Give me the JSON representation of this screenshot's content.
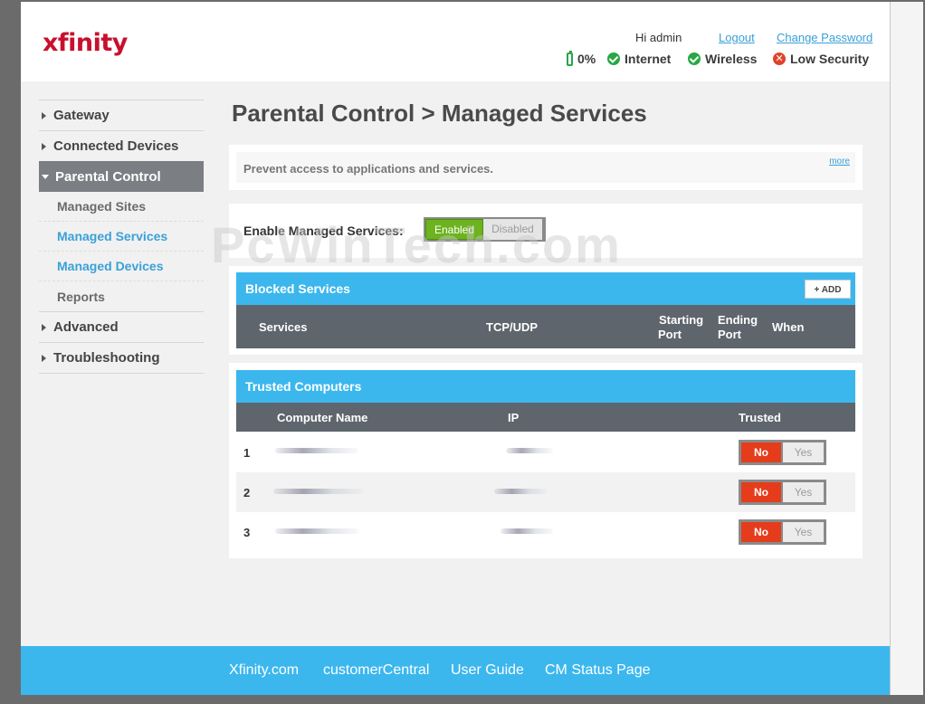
{
  "header": {
    "logo": "xfinity",
    "greeting": "Hi admin",
    "logout": "Logout",
    "change_password": "Change Password",
    "battery": "0%",
    "internet": "Internet",
    "wireless": "Wireless",
    "security": "Low Security"
  },
  "sidebar": {
    "gateway": "Gateway",
    "connected_devices": "Connected Devices",
    "parental_control": "Parental Control",
    "managed_sites": "Managed Sites",
    "managed_services": "Managed Services",
    "managed_devices": "Managed Devices",
    "reports": "Reports",
    "advanced": "Advanced",
    "troubleshooting": "Troubleshooting"
  },
  "main": {
    "title": "Parental Control > Managed Services",
    "description": "Prevent access to applications and services.",
    "more": "more",
    "enable_label": "Enable Managed Services:",
    "enabled": "Enabled",
    "disabled": "Disabled",
    "toggle_state": "Enabled"
  },
  "blocked": {
    "title": "Blocked Services",
    "add": "+ ADD",
    "columns": {
      "services": "Services",
      "protocol": "TCP/UDP",
      "start1": "Starting",
      "start2": "Port",
      "end1": "Ending",
      "end2": "Port",
      "when": "When"
    }
  },
  "trusted": {
    "title": "Trusted Computers",
    "columns": {
      "name": "Computer Name",
      "ip": "IP",
      "trusted": "Trusted"
    },
    "no": "No",
    "yes": "Yes",
    "rows": [
      {
        "num": "1",
        "trusted": "No"
      },
      {
        "num": "2",
        "trusted": "No"
      },
      {
        "num": "3",
        "trusted": "No"
      }
    ]
  },
  "watermark": "PcWinTech.com",
  "footer": {
    "xfinity": "Xfinity.com",
    "customer_central": "customerCentral",
    "user_guide": "User Guide",
    "cm_status": "CM Status Page"
  },
  "colors": {
    "accent_blue": "#3bb7ee",
    "brand_red": "#c8102e",
    "enabled_green": "#6cb31f",
    "no_red": "#e53c1c",
    "header_grey": "#5e656c"
  }
}
